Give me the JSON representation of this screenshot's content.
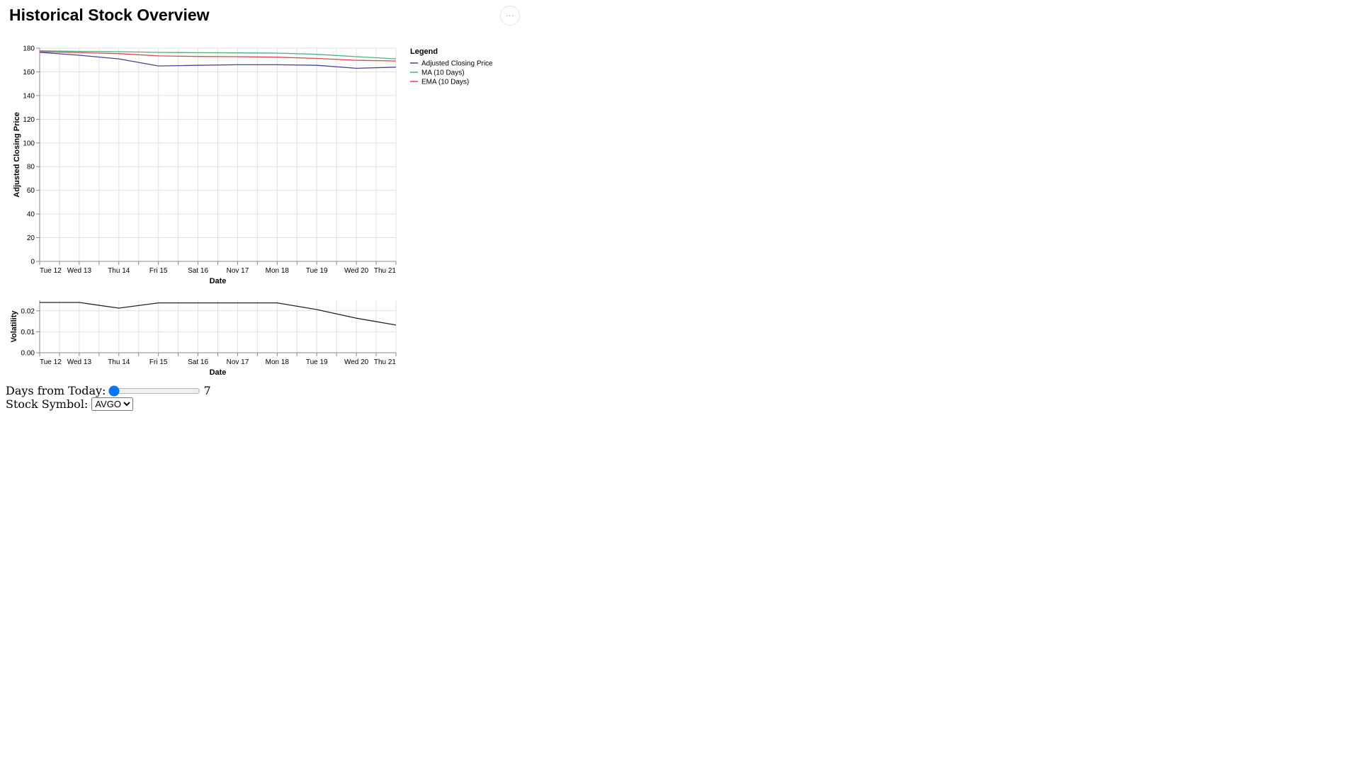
{
  "page": {
    "title": "Historical Stock Overview"
  },
  "actions_menu": {
    "icon": "more-horizontal-icon",
    "label": "⋯"
  },
  "chart_data": [
    {
      "type": "line",
      "xlabel": "Date",
      "ylabel": "Adjusted Closing Price",
      "x": [
        "Tue 12",
        "Wed 13",
        "Thu 14",
        "Fri 15",
        "Sat 16",
        "Nov 17",
        "Mon 18",
        "Tue 19",
        "Wed 20",
        "Thu 21"
      ],
      "x_tick_labels": [
        "Tue 12",
        "Wed 13",
        "Thu 14",
        "Fri 15",
        "Sat 16",
        "Nov 17",
        "Mon 18",
        "Tue 19",
        "Wed 20",
        "Thu 21"
      ],
      "ylim": [
        0,
        180
      ],
      "y_ticks": [
        0,
        20,
        40,
        60,
        80,
        100,
        120,
        140,
        160,
        180
      ],
      "grid": true,
      "legend": {
        "title": "Legend",
        "position": "right"
      },
      "series": [
        {
          "name": "Adjusted Closing Price",
          "color": "#4c3d9e",
          "values": [
            176.5,
            174.0,
            171.0,
            165.0,
            165.5,
            166.0,
            166.0,
            165.5,
            163.0,
            164.0
          ]
        },
        {
          "name": "MA (10 Days)",
          "color": "#4caf7d",
          "values": [
            177.8,
            177.3,
            177.0,
            176.5,
            176.2,
            176.0,
            175.8,
            174.8,
            172.8,
            171.0
          ]
        },
        {
          "name": "EMA (10 Days)",
          "color": "#e0454e",
          "values": [
            177.0,
            176.3,
            175.4,
            173.5,
            173.0,
            172.8,
            172.4,
            171.3,
            169.8,
            169.2
          ]
        }
      ]
    },
    {
      "type": "line",
      "xlabel": "Date",
      "ylabel": "Volatility",
      "x": [
        "Tue 12",
        "Wed 13",
        "Thu 14",
        "Fri 15",
        "Sat 16",
        "Nov 17",
        "Mon 18",
        "Tue 19",
        "Wed 20",
        "Thu 21"
      ],
      "x_tick_labels": [
        "Tue 12",
        "Wed 13",
        "Thu 14",
        "Fri 15",
        "Sat 16",
        "Nov 17",
        "Mon 18",
        "Tue 19",
        "Wed 20",
        "Thu 21"
      ],
      "ylim": [
        0,
        0.025
      ],
      "y_ticks": [
        0,
        0.01,
        0.02
      ],
      "y_tick_labels": [
        "0.00",
        "0.01",
        "0.02"
      ],
      "grid": true,
      "series": [
        {
          "color": "#222222",
          "values": [
            0.024,
            0.024,
            0.0213,
            0.0238,
            0.0238,
            0.0238,
            0.0238,
            0.0206,
            0.0165,
            0.0132
          ]
        }
      ]
    }
  ],
  "controls": {
    "days_label": "Days from Today:",
    "days_value": 7,
    "days_min": 7,
    "days_max": 365,
    "symbol_label": "Stock Symbol:",
    "symbol_value": "AVGO",
    "symbol_options": [
      "AVGO"
    ]
  }
}
